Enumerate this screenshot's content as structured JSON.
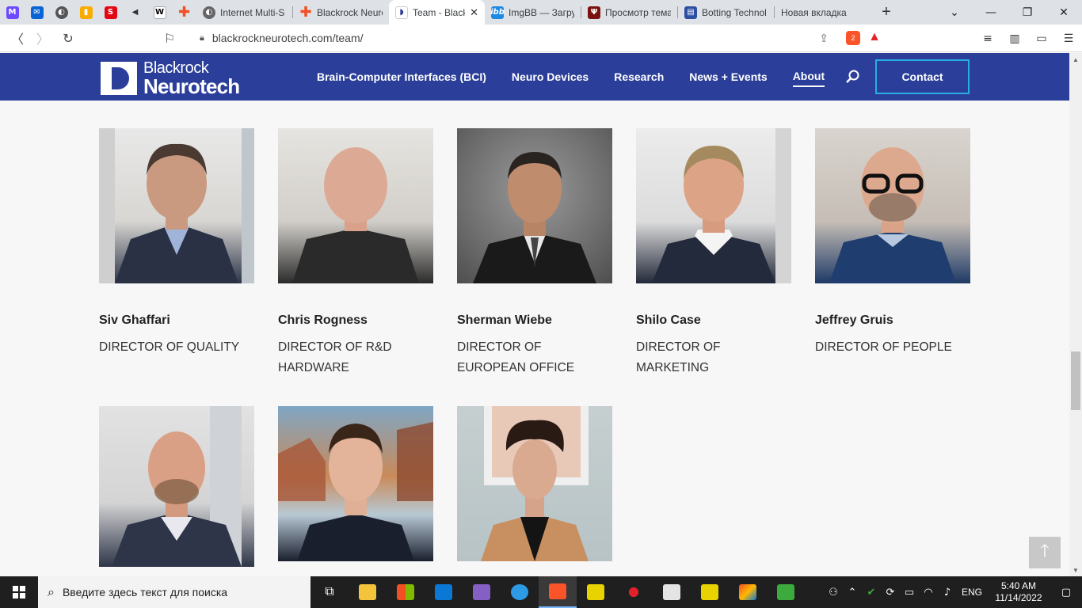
{
  "browser": {
    "tabs": [
      {
        "title": "Internet Multi-S",
        "icon": "globe-icon"
      },
      {
        "title": "Blackrock Neuro",
        "icon": "plus-icon"
      },
      {
        "title": "Team - Blackrock",
        "icon": "blackrock-icon",
        "active": true
      },
      {
        "title": "ImgBB — Загру",
        "icon": "imgbb-icon"
      },
      {
        "title": "Просмотр тема",
        "icon": "psi-icon"
      },
      {
        "title": "Botting Technol",
        "icon": "botting-icon"
      },
      {
        "title": "Новая вкладка",
        "icon": "none"
      }
    ],
    "url": "blackrockneurotech.com/team/",
    "brave_badge": "2"
  },
  "site": {
    "logo_line1": "Blackrock",
    "logo_line2": "Neurotech",
    "nav": [
      "Brain-Computer Interfaces (BCI)",
      "Neuro Devices",
      "Research",
      "News + Events",
      "About"
    ],
    "active_nav": "About",
    "contact": "Contact"
  },
  "team": [
    {
      "name": "Siv Ghaffari",
      "role": "DIRECTOR OF QUALITY"
    },
    {
      "name": "Chris Rogness",
      "role": "DIRECTOR OF R&D HARDWARE"
    },
    {
      "name": "Sherman Wiebe",
      "role": "DIRECTOR OF EUROPEAN OFFICE"
    },
    {
      "name": "Shilo Case",
      "role": "DIRECTOR OF MARKETING"
    },
    {
      "name": "Jeffrey Gruis",
      "role": "DIRECTOR OF PEOPLE"
    }
  ],
  "taskbar": {
    "search_placeholder": "Введите здесь текст для поиска",
    "lang": "ENG",
    "time": "5:40 AM",
    "date": "11/14/2022"
  }
}
